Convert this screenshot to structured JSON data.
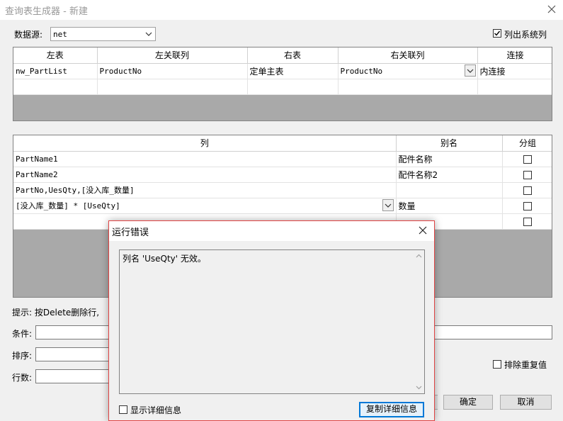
{
  "window": {
    "title": "查询表生成器 - 新建"
  },
  "datasource": {
    "label": "数据源:",
    "value": "net"
  },
  "list_system_tables": {
    "label": "列出系统列",
    "checked": true
  },
  "join_grid": {
    "headers": [
      "左表",
      "左关联列",
      "右表",
      "右关联列",
      "连接"
    ],
    "rows": [
      [
        "nw_PartList",
        "ProductNo",
        "定单主表",
        "ProductNo",
        "内连接"
      ]
    ]
  },
  "column_grid": {
    "headers": [
      "列",
      "别名",
      "分组"
    ],
    "rows": [
      {
        "column": "PartName1",
        "alias": "配件名称"
      },
      {
        "column": "PartName2",
        "alias": "配件名称2"
      },
      {
        "column": "PartNo,UesQty,[没入库_数量]",
        "alias": ""
      },
      {
        "column": "[没入库_数量] * [UseQty]",
        "alias": "数量"
      },
      {
        "column": "",
        "alias": ""
      }
    ]
  },
  "hint": "提示: 按Delete删除行,",
  "fields": {
    "condition_label": "条件:",
    "sort_label": "排序:",
    "rows_label": "行数:"
  },
  "dedupe": {
    "label": "排除重复值",
    "checked": false
  },
  "buttons": {
    "ok": "确定",
    "cancel": "取消"
  },
  "error_dialog": {
    "title": "运行错误",
    "message": "列名 'UseQty' 无效。",
    "show_details_label": "显示详细信息",
    "copy_details_label": "复制详细信息"
  }
}
